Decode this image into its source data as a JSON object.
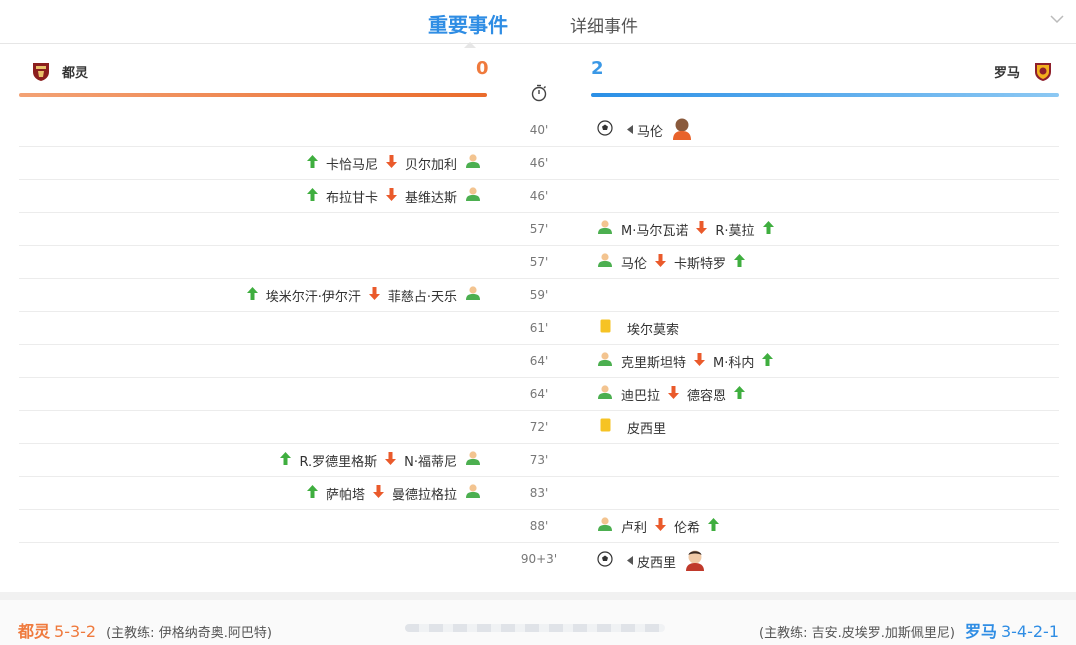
{
  "tabs": {
    "main": "重要事件",
    "other": "详细事件"
  },
  "home": {
    "name": "都灵",
    "score": "0",
    "color": "#ef7a3d",
    "formation": "5-3-2",
    "coach": "(主教练: 伊格纳奇奥.阿巴特)"
  },
  "away": {
    "name": "罗马",
    "score": "2",
    "color": "#3a98e6",
    "formation": "3-4-2-1",
    "coach": "(主教练: 吉安.皮埃罗.加斯佩里尼)"
  },
  "events": [
    {
      "minute": "40'",
      "side": "away",
      "type": "goal",
      "player": "马伦"
    },
    {
      "minute": "46'",
      "side": "home",
      "type": "sub",
      "in": "卡恰马尼",
      "out": "贝尔加利"
    },
    {
      "minute": "46'",
      "side": "home",
      "type": "sub",
      "in": "布拉甘卡",
      "out": "基维达斯"
    },
    {
      "minute": "57'",
      "side": "away",
      "type": "sub",
      "out": "M·马尔瓦诺",
      "in": "R·莫拉"
    },
    {
      "minute": "57'",
      "side": "away",
      "type": "sub",
      "out": "马伦",
      "in": "卡斯特罗"
    },
    {
      "minute": "59'",
      "side": "home",
      "type": "sub",
      "in": "埃米尔汗·伊尔汗",
      "out": "菲慈占·天乐"
    },
    {
      "minute": "61'",
      "side": "away",
      "type": "yellow",
      "player": "埃尔莫索"
    },
    {
      "minute": "64'",
      "side": "away",
      "type": "sub",
      "out": "克里斯坦特",
      "in": "M·科内"
    },
    {
      "minute": "64'",
      "side": "away",
      "type": "sub",
      "out": "迪巴拉",
      "in": "德容恩"
    },
    {
      "minute": "72'",
      "side": "away",
      "type": "yellow",
      "player": "皮西里"
    },
    {
      "minute": "73'",
      "side": "home",
      "type": "sub",
      "in": "R.罗德里格斯",
      "out": "N·福蒂尼"
    },
    {
      "minute": "83'",
      "side": "home",
      "type": "sub",
      "in": "萨帕塔",
      "out": "曼德拉格拉"
    },
    {
      "minute": "88'",
      "side": "away",
      "type": "sub",
      "out": "卢利",
      "in": "伦希"
    },
    {
      "minute": "90+3'",
      "side": "away",
      "type": "goal",
      "player": "皮西里"
    }
  ]
}
